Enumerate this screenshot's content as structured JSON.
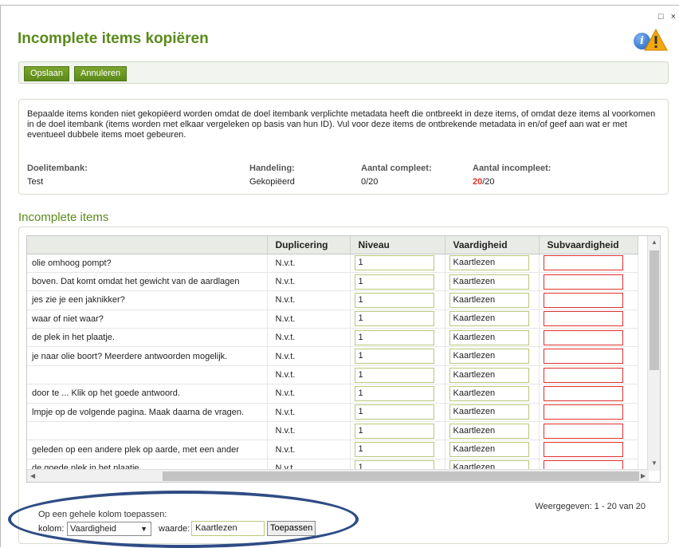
{
  "window": {
    "controls": [
      "□",
      "×"
    ]
  },
  "page": {
    "title": "Incomplete items kopiëren"
  },
  "toolbar": {
    "save_label": "Opslaan",
    "cancel_label": "Annuleren"
  },
  "info": {
    "message": "Bepaalde items konden niet gekopiëerd worden omdat de doel itembank verplichte metadata heeft die ontbreekt in deze items, of omdat deze items al voorkomen in de doel itembank (items worden met elkaar vergeleken op basis van hun ID). Vul voor deze items de ontbrekende metadata in en/of geef aan wat er met eventueel dubbele items moet gebeuren.",
    "target_label": "Doelitembank:",
    "target_value": "Test",
    "action_label": "Handeling:",
    "action_value": "Gekopiëerd",
    "complete_label": "Aantal compleet:",
    "complete_value": "0/20",
    "incomplete_label": "Aantal incompleet:",
    "incomplete_count": "20",
    "incomplete_total": "/20"
  },
  "section": {
    "title": "Incomplete items"
  },
  "grid": {
    "columns": [
      "",
      "Duplicering",
      "Niveau",
      "Vaardigheid",
      "Subvaardigheid"
    ],
    "rows": [
      {
        "text": "olie omhoog pompt?",
        "dup": "N.v.t.",
        "niveau": "1",
        "vaardigheid": "Kaartlezen",
        "sub": ""
      },
      {
        "text": "boven. Dat komt omdat het gewicht van de aardlagen",
        "dup": "N.v.t.",
        "niveau": "1",
        "vaardigheid": "Kaartlezen",
        "sub": ""
      },
      {
        "text": "jes zie je een jaknikker?",
        "dup": "N.v.t.",
        "niveau": "1",
        "vaardigheid": "Kaartlezen",
        "sub": ""
      },
      {
        "text": "waar of niet waar?",
        "dup": "N.v.t.",
        "niveau": "1",
        "vaardigheid": "Kaartlezen",
        "sub": ""
      },
      {
        "text": "de plek in het plaatje.",
        "dup": "N.v.t.",
        "niveau": "1",
        "vaardigheid": "Kaartlezen",
        "sub": ""
      },
      {
        "text": "je naar olie boort? Meerdere antwoorden mogelijk.",
        "dup": "N.v.t.",
        "niveau": "1",
        "vaardigheid": "Kaartlezen",
        "sub": ""
      },
      {
        "text": "",
        "dup": "N.v.t.",
        "niveau": "1",
        "vaardigheid": "Kaartlezen",
        "sub": ""
      },
      {
        "text": "door te ... Klik op het goede antwoord.",
        "dup": "N.v.t.",
        "niveau": "1",
        "vaardigheid": "Kaartlezen",
        "sub": ""
      },
      {
        "text": "lmpje op de volgende pagina. Maak daarna de vragen.",
        "dup": "N.v.t.",
        "niveau": "1",
        "vaardigheid": "Kaartlezen",
        "sub": ""
      },
      {
        "text": "",
        "dup": "N.v.t.",
        "niveau": "1",
        "vaardigheid": "Kaartlezen",
        "sub": ""
      },
      {
        "text": "geleden op een andere plek op aarde, met een ander",
        "dup": "N.v.t.",
        "niveau": "1",
        "vaardigheid": "Kaartlezen",
        "sub": ""
      },
      {
        "text": "de goede plek in het plaatje.",
        "dup": "N.v.t.",
        "niveau": "1",
        "vaardigheid": "Kaartlezen",
        "sub": ""
      }
    ]
  },
  "bulk": {
    "apply_label": "Op een gehele kolom toepassen:",
    "column_label": "kolom:",
    "column_value": "Vaardigheid",
    "value_label": "waarde:",
    "value_value": "Kaartlezen",
    "apply_button": "Toepassen"
  },
  "pager": {
    "text": "Weergegeven: 1 - 20 van 20"
  },
  "colors": {
    "accent": "#5a8a1a",
    "button": "#6a9a22",
    "error": "#e03030",
    "annotation": "#2f4c85"
  }
}
